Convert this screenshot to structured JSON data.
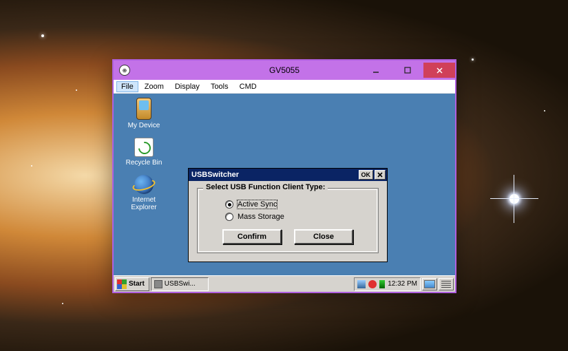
{
  "host_window": {
    "title": "GV5055",
    "menu": [
      "File",
      "Zoom",
      "Display",
      "Tools",
      "CMD"
    ],
    "menu_selected_index": 0
  },
  "ce_desktop": {
    "icons": [
      {
        "name": "my-device",
        "label": "My Device"
      },
      {
        "name": "recycle-bin",
        "label": "Recycle Bin"
      },
      {
        "name": "internet-explorer",
        "label": "Internet Explorer"
      }
    ]
  },
  "ce_taskbar": {
    "start_label": "Start",
    "task_label": "USBSwi...",
    "clock": "12:32 PM"
  },
  "dialog": {
    "title": "USBSwitcher",
    "ok_label": "OK",
    "group_label": "Select USB Function Client Type:",
    "options": [
      {
        "label": "Active Sync",
        "selected": true
      },
      {
        "label": "Mass Storage",
        "selected": false
      }
    ],
    "confirm_label": "Confirm",
    "close_label": "Close"
  }
}
